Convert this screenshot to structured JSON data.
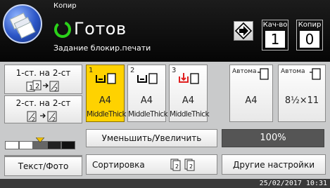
{
  "header": {
    "app_title": "Копир",
    "status": "Готов",
    "substatus": "Задание блокир.печати",
    "counters": [
      {
        "label": "Кач-во",
        "value": "1"
      },
      {
        "label": "Копир",
        "value": "0"
      }
    ]
  },
  "duplex": {
    "one_to_two": "1-ст. на 2-ст",
    "two_to_two": "2-ст. на 2-ст"
  },
  "trays": [
    {
      "number": "1",
      "paper": "A4",
      "type": "MiddleThick",
      "selected": true
    },
    {
      "number": "2",
      "paper": "A4",
      "type": "MiddleThick",
      "selected": false
    },
    {
      "number": "3",
      "paper": "A4",
      "type": "MiddleThick",
      "selected": false
    },
    {
      "label": "Автома",
      "paper": "A4",
      "selected": false
    },
    {
      "label": "Автома",
      "paper": "8½×11",
      "selected": false
    }
  ],
  "buttons": {
    "reduce_enlarge": "Уменьшить/Увеличить",
    "zoom_value": "100%",
    "text_photo": "Текст/Фото",
    "sort": "Сортировка",
    "other_settings": "Другие настройки"
  },
  "footer": {
    "datetime": "25/02/2017 10:31"
  },
  "colors": {
    "selected_tray": "#ffd200",
    "header_bg": "#111111",
    "panel_bg": "#c9cacb",
    "status_ring": "#2bd11a",
    "bin_arrow": "#e02020"
  }
}
